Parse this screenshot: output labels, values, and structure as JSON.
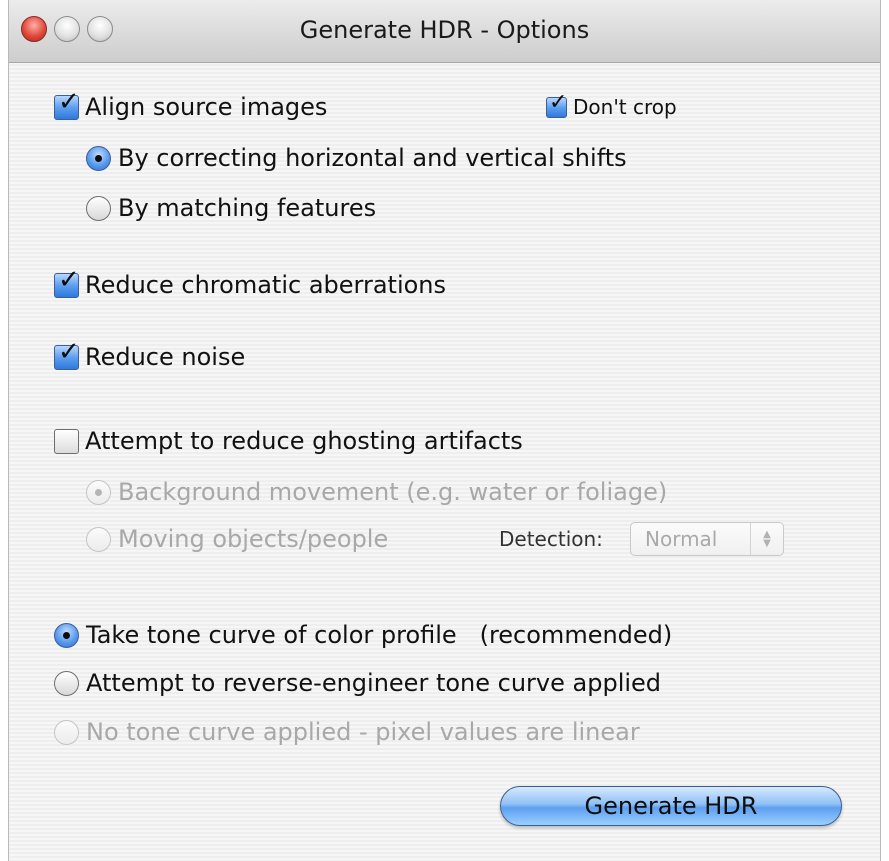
{
  "window": {
    "title": "Generate HDR - Options"
  },
  "options": {
    "align": {
      "label": "Align source images",
      "checked": true
    },
    "dont_crop": {
      "label": "Don't crop",
      "checked": true
    },
    "align_shifts": {
      "label": "By correcting horizontal and vertical shifts",
      "selected": true
    },
    "align_features": {
      "label": "By matching features",
      "selected": false
    },
    "chromatic": {
      "label": "Reduce chromatic aberrations",
      "checked": true
    },
    "noise": {
      "label": "Reduce noise",
      "checked": true
    },
    "ghosting": {
      "label": "Attempt to reduce ghosting artifacts",
      "checked": false
    },
    "ghost_background": {
      "label": "Background movement (e.g. water or foliage)",
      "selected": true,
      "enabled": false
    },
    "ghost_moving": {
      "label": "Moving objects/people",
      "selected": false,
      "enabled": false
    },
    "detection": {
      "label": "Detection:",
      "value": "Normal",
      "enabled": false
    },
    "tone_profile": {
      "label": "Take tone curve of color profile   (recommended)",
      "selected": true
    },
    "tone_reverse": {
      "label": "Attempt to reverse-engineer tone curve applied",
      "selected": false
    },
    "tone_linear": {
      "label": "No tone curve applied - pixel values are linear",
      "selected": false,
      "enabled": false
    }
  },
  "buttons": {
    "generate": "Generate HDR"
  },
  "colors": {
    "accent": "#5e9ff0",
    "disabled_text": "#a8a8a8"
  }
}
